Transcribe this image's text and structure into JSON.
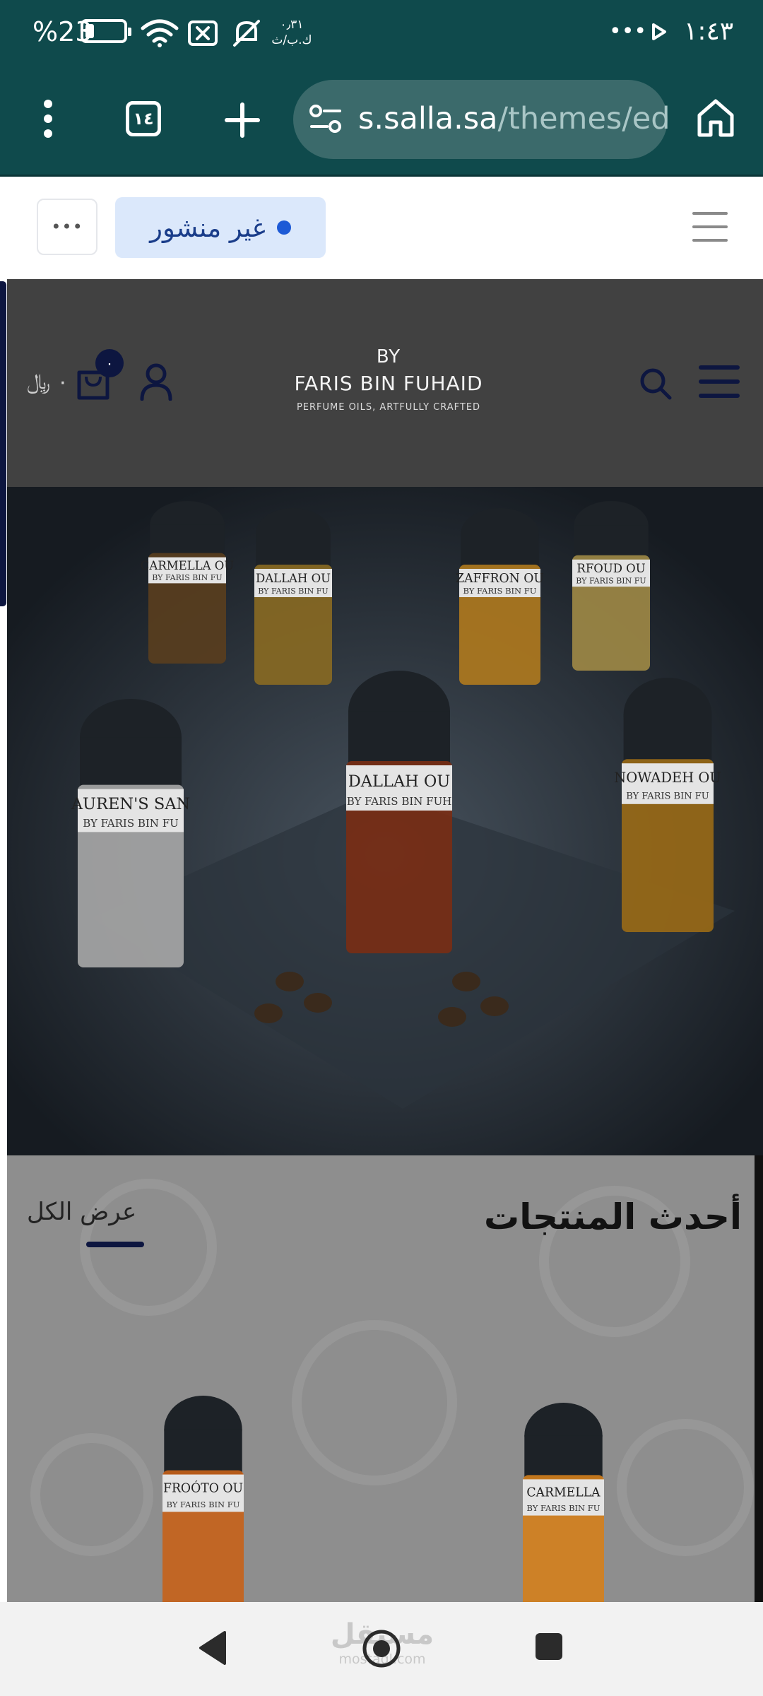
{
  "status_bar": {
    "battery_text": "%23",
    "battery_level": 0.23,
    "network_speed": "٠٫٣١\nك.ب/ث",
    "more": "•••",
    "time": "١:٤٣"
  },
  "browser": {
    "tab_count": "١٤",
    "url_host": "s.salla.sa",
    "url_path": "/themes/ed",
    "icons": [
      "menu-dots-icon",
      "tabs-icon",
      "new-tab-icon",
      "site-settings-icon",
      "home-icon"
    ]
  },
  "editor": {
    "more_label": "•••",
    "publish_status": "غير منشور",
    "status_color": "#1d5ad6"
  },
  "store": {
    "brand_by": "BY",
    "brand_name": "FARIS BIN FUHAID",
    "brand_tagline": "PERFUME OILS, ARTFULLY CRAFTED",
    "cart_count": "٠",
    "cart_total": "٠ ﷼",
    "header_color": "#414141"
  },
  "hero": {
    "bottles": [
      {
        "label": "CARMELLA OU",
        "sub": "BY FARIS BIN FU"
      },
      {
        "label": "DALLAH OU",
        "sub": "BY FARIS BIN FU"
      },
      {
        "label": "ZAFFRON OU",
        "sub": "BY FARIS BIN FU"
      },
      {
        "label": "RFOUD OU",
        "sub": "BY FARIS BIN FU"
      },
      {
        "label": "DALLAH OU",
        "sub": "BY FARIS BIN FUH"
      },
      {
        "label": "NOWADEH OU",
        "sub": "BY FARIS BIN FU"
      },
      {
        "label": "AUREN'S SAN",
        "sub": "BY FARIS BIN FU"
      }
    ]
  },
  "products": {
    "title": "أحدث المنتجات",
    "view_all": "عرض الكل",
    "items": [
      {
        "label": "FROÓTO OU",
        "sub": "BY FARIS BIN FU"
      },
      {
        "label": "CARMELLA",
        "sub": "BY FARIS BIN FU"
      }
    ]
  },
  "nav": {
    "icons": [
      "back-icon",
      "home-circle-icon",
      "recents-icon"
    ],
    "watermark": "مستقل",
    "watermark_sub": "mostaql.com"
  }
}
